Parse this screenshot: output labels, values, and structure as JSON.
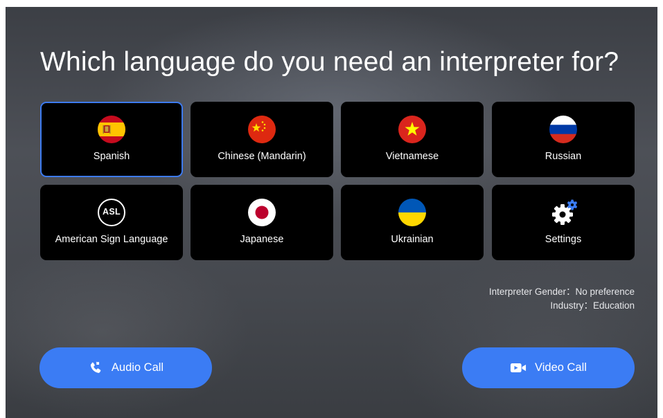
{
  "title": "Which language do you need an interpreter for?",
  "languages": [
    {
      "label": "Spanish",
      "icon": "spain-flag-icon",
      "selected": true
    },
    {
      "label": "Chinese (Mandarin)",
      "icon": "china-flag-icon",
      "selected": false
    },
    {
      "label": "Vietnamese",
      "icon": "vietnam-flag-icon",
      "selected": false
    },
    {
      "label": "Russian",
      "icon": "russia-flag-icon",
      "selected": false
    },
    {
      "label": "American Sign Language",
      "icon": "asl-icon",
      "badge": "ASL",
      "selected": false
    },
    {
      "label": "Japanese",
      "icon": "japan-flag-icon",
      "selected": false
    },
    {
      "label": "Ukrainian",
      "icon": "ukraine-flag-icon",
      "selected": false
    },
    {
      "label": "Settings",
      "icon": "gear-icon",
      "selected": false
    }
  ],
  "info": {
    "gender": "Interpreter Gender：No preference",
    "industry": "Industry：Education"
  },
  "buttons": {
    "audio": {
      "label": "Audio Call",
      "icon": "phone-icon"
    },
    "video": {
      "label": "Video Call",
      "icon": "video-camera-icon"
    }
  },
  "colors": {
    "accent": "#3b7cf4",
    "selected_border": "#3d7bf0",
    "tile_background": "#000000",
    "settings_gear_accent": "#3b7cf4"
  }
}
